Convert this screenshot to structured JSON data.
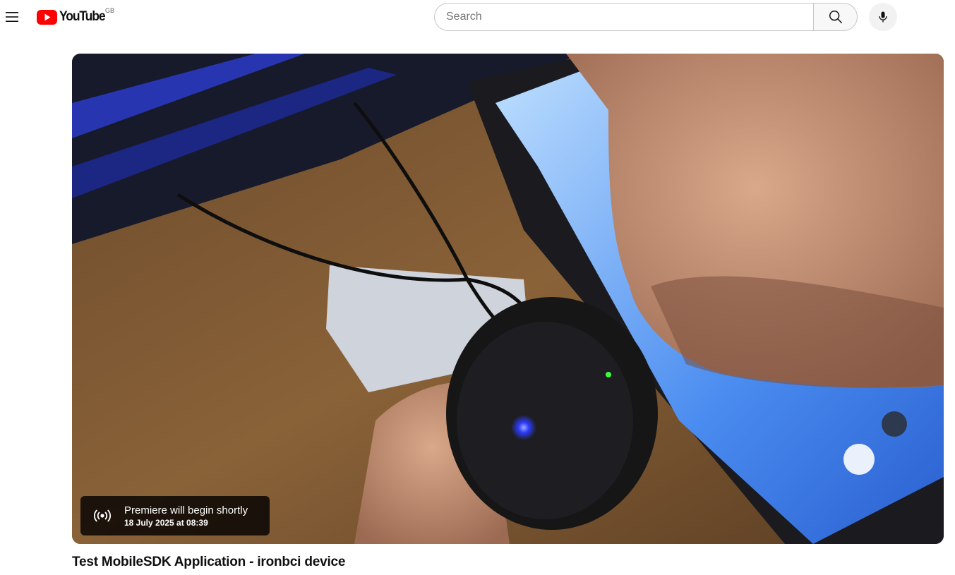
{
  "header": {
    "logo_text": "YouTube",
    "country_code": "GB",
    "search_placeholder": "Search",
    "icons": {
      "menu": "hamburger-menu-icon",
      "logo": "youtube-play-icon",
      "search": "search-icon",
      "mic": "microphone-icon"
    }
  },
  "player": {
    "thumbnail_icon": "video-thumbnail",
    "premiere": {
      "icon": "live-broadcast-icon",
      "title": "Premiere will begin shortly",
      "date": "18 July 2025 at 08:39"
    }
  },
  "video": {
    "title": "Test MobileSDK Application - ironbci device"
  },
  "colors": {
    "brand_red": "#ff0000",
    "text": "#0f0f0f",
    "search_border": "#c6c6c6"
  }
}
